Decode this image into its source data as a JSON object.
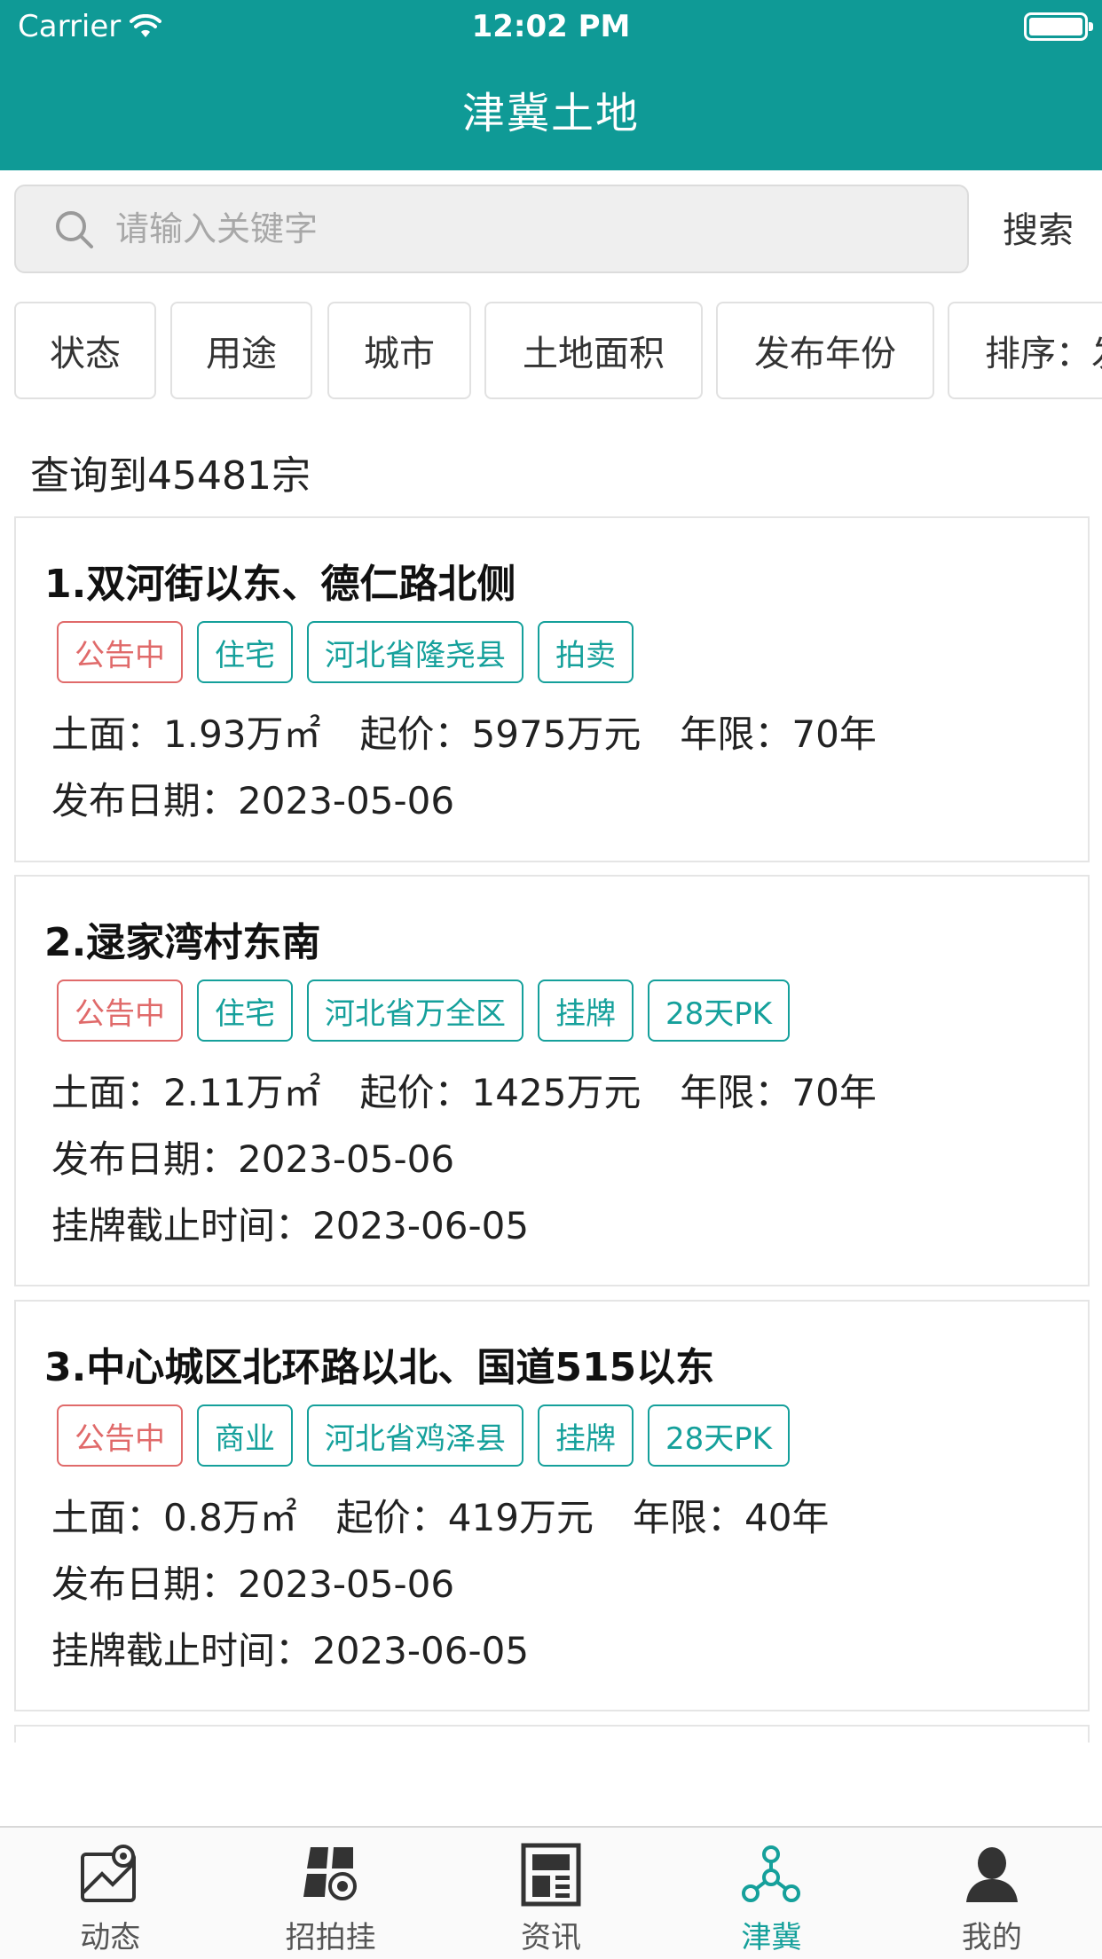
{
  "status_bar": {
    "carrier": "Carrier",
    "time": "12:02 PM"
  },
  "header": {
    "title": "津冀土地"
  },
  "search": {
    "placeholder": "请输入关键字",
    "button_label": "搜索"
  },
  "filters": [
    {
      "label": "状态"
    },
    {
      "label": "用途"
    },
    {
      "label": "城市"
    },
    {
      "label": "土地面积"
    },
    {
      "label": "发布年份"
    },
    {
      "label": "排序：发"
    }
  ],
  "result_count": "查询到45481宗",
  "listings": [
    {
      "title": "1.双河街以东、德仁路北侧",
      "tags": [
        "公告中",
        "住宅",
        "河北省隆尧县",
        "拍卖"
      ],
      "area": "土面：1.93万㎡",
      "start_price": "起价：5975万元",
      "term": "年限：70年",
      "publish_date": "发布日期：2023-05-06"
    },
    {
      "title": "2.逯家湾村东南",
      "tags": [
        "公告中",
        "住宅",
        "河北省万全区",
        "挂牌",
        "28天PK"
      ],
      "area": "土面：2.11万㎡",
      "start_price": "起价：1425万元",
      "term": "年限：70年",
      "publish_date": "发布日期：2023-05-06",
      "deadline": "挂牌截止时间：2023-06-05"
    },
    {
      "title": "3.中心城区北环路以北、国道515以东",
      "tags": [
        "公告中",
        "商业",
        "河北省鸡泽县",
        "挂牌",
        "28天PK"
      ],
      "area": "土面：0.8万㎡",
      "start_price": "起价：419万元",
      "term": "年限：40年",
      "publish_date": "发布日期：2023-05-06",
      "deadline": "挂牌截止时间：2023-06-05"
    }
  ],
  "tabbar": {
    "items": [
      {
        "label": "动态",
        "icon": "map-icon"
      },
      {
        "label": "招拍挂",
        "icon": "auction-icon"
      },
      {
        "label": "资讯",
        "icon": "news-icon"
      },
      {
        "label": "津冀",
        "icon": "network-icon"
      },
      {
        "label": "我的",
        "icon": "user-icon"
      }
    ],
    "active_index": 3
  },
  "colors": {
    "brand": "#0f9a96",
    "tag_teal": "#15a09b",
    "tag_status_red": "#e06a6a"
  }
}
